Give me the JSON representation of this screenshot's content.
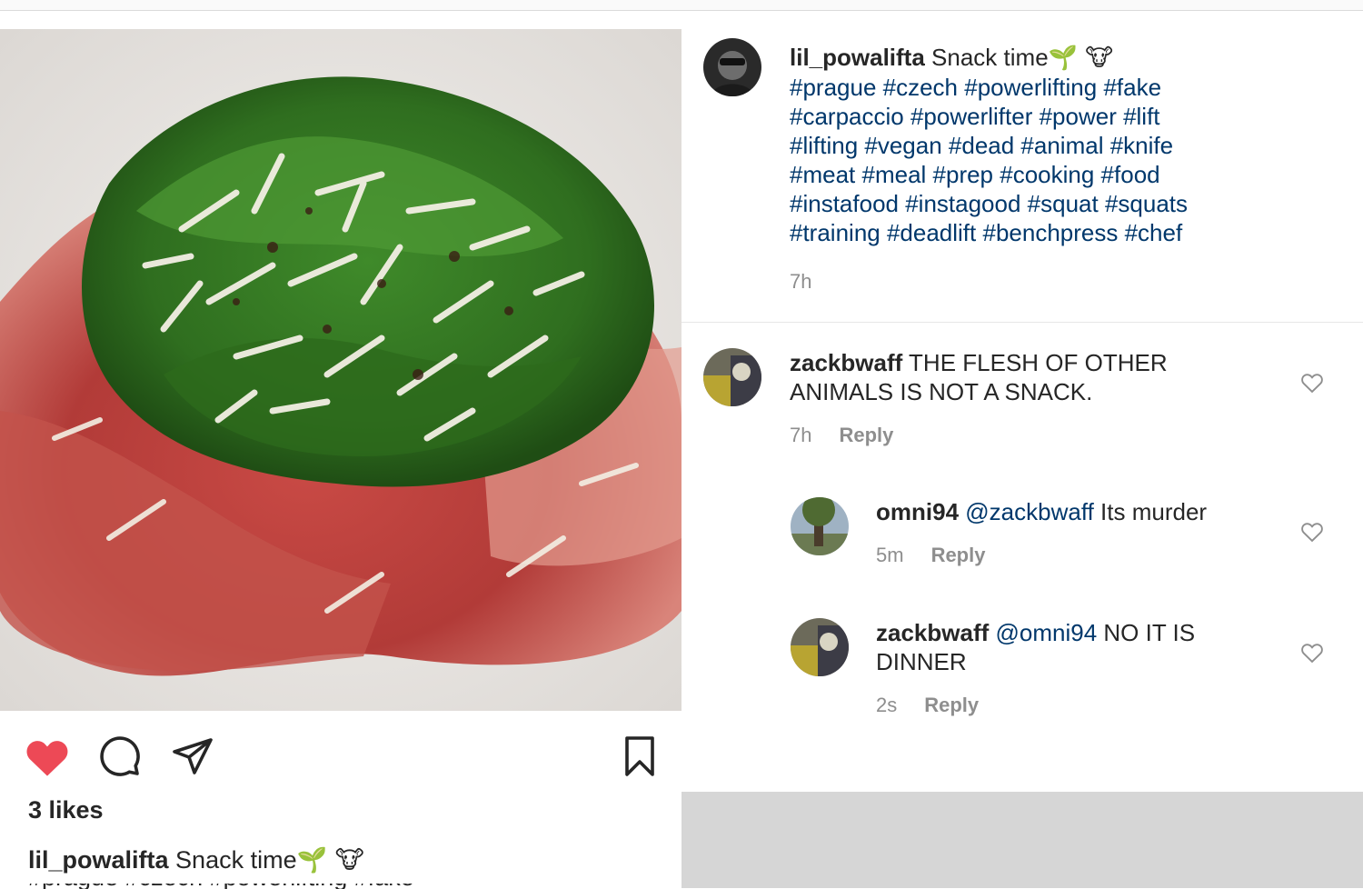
{
  "post": {
    "username": "lil_powalifta",
    "caption_text": "Snack time",
    "caption_emojis": "🌱 🐮",
    "hashtags": [
      "#prague #czech #powerlifting #fake",
      "#carpaccio #powerlifter #power #lift",
      "#lifting #vegan #dead #animal #knife",
      "#meat #meal #prep #cooking #food",
      "#instafood #instagood #squat #squats",
      "#training #deadlift #benchpress #chef"
    ],
    "time": "7h"
  },
  "comments": [
    {
      "username": "zackbwaff",
      "mention": "",
      "text_lines": [
        "THE FLESH OF OTHER",
        "ANIMALS IS NOT A SNACK."
      ],
      "time": "7h",
      "reply_label": "Reply"
    },
    {
      "username": "omni94",
      "mention": "@zackbwaff",
      "text_lines": [
        "Its murder"
      ],
      "time": "5m",
      "reply_label": "Reply"
    },
    {
      "username": "zackbwaff",
      "mention": "@omni94",
      "text_lines": [
        "NO IT IS",
        "DINNER"
      ],
      "time": "2s",
      "reply_label": "Reply"
    }
  ],
  "actions": {
    "liked": true,
    "likes_text": "3 likes"
  },
  "colors": {
    "like_red": "#ed4956",
    "link_blue": "#00376b",
    "meta_gray": "#8e8e8e"
  },
  "icons": [
    "heart-icon",
    "comment-icon",
    "share-icon",
    "bookmark-icon",
    "heart-outline-icon"
  ]
}
